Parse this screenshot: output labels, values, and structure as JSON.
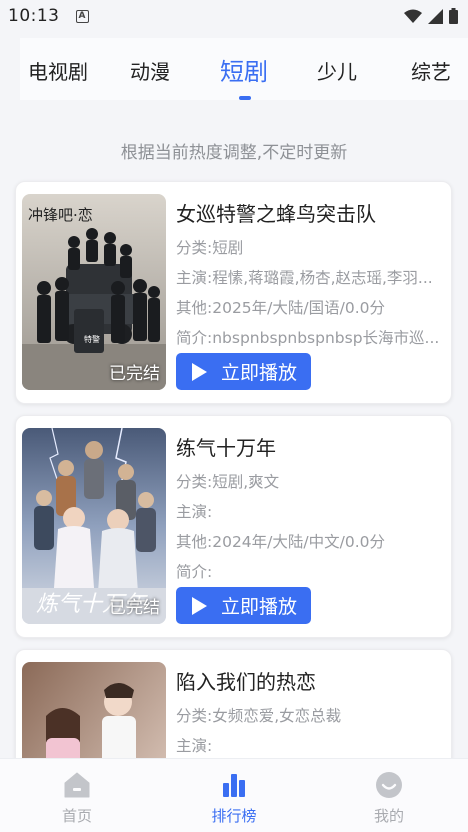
{
  "status_bar": {
    "time": "10:13",
    "badge": "A"
  },
  "tabs": [
    {
      "label": "电视剧",
      "active": false
    },
    {
      "label": "动漫",
      "active": false
    },
    {
      "label": "短剧",
      "active": true
    },
    {
      "label": "少儿",
      "active": false
    },
    {
      "label": "综艺",
      "active": false
    }
  ],
  "notice": "根据当前热度调整,不定时更新",
  "cards": [
    {
      "title": "女巡特警之蜂鸟突击队",
      "category": "分类:短剧",
      "cast": "主演:程愫,蒋璐霞,杨杏,赵志瑶,李羽...",
      "other": "其他:2025年/大陆/国语/0.0分",
      "intro": "简介:nbspnbspnbspnbsp长海市巡...",
      "status": "已完结",
      "play_label": "立即播放",
      "poster_title": "冲锋吧·恋",
      "poster_sign": "特警"
    },
    {
      "title": "练气十万年",
      "category": "分类:短剧,爽文",
      "cast": "主演:",
      "other": "其他:2024年/大陆/中文/0.0分",
      "intro": "简介:",
      "status": "已完结",
      "play_label": "立即播放",
      "poster_title": "炼气十万年"
    },
    {
      "title": "陷入我们的热恋",
      "category": "分类:女频恋爱,女恋总裁",
      "cast": "主演:"
    }
  ],
  "bottom_nav": [
    {
      "label": "首页",
      "icon": "home-icon",
      "active": false
    },
    {
      "label": "排行榜",
      "icon": "bar-chart-icon",
      "active": true
    },
    {
      "label": "我的",
      "icon": "smile-icon",
      "active": false
    }
  ],
  "colors": {
    "accent": "#3a6ef2",
    "muted": "#9a9ca1"
  }
}
